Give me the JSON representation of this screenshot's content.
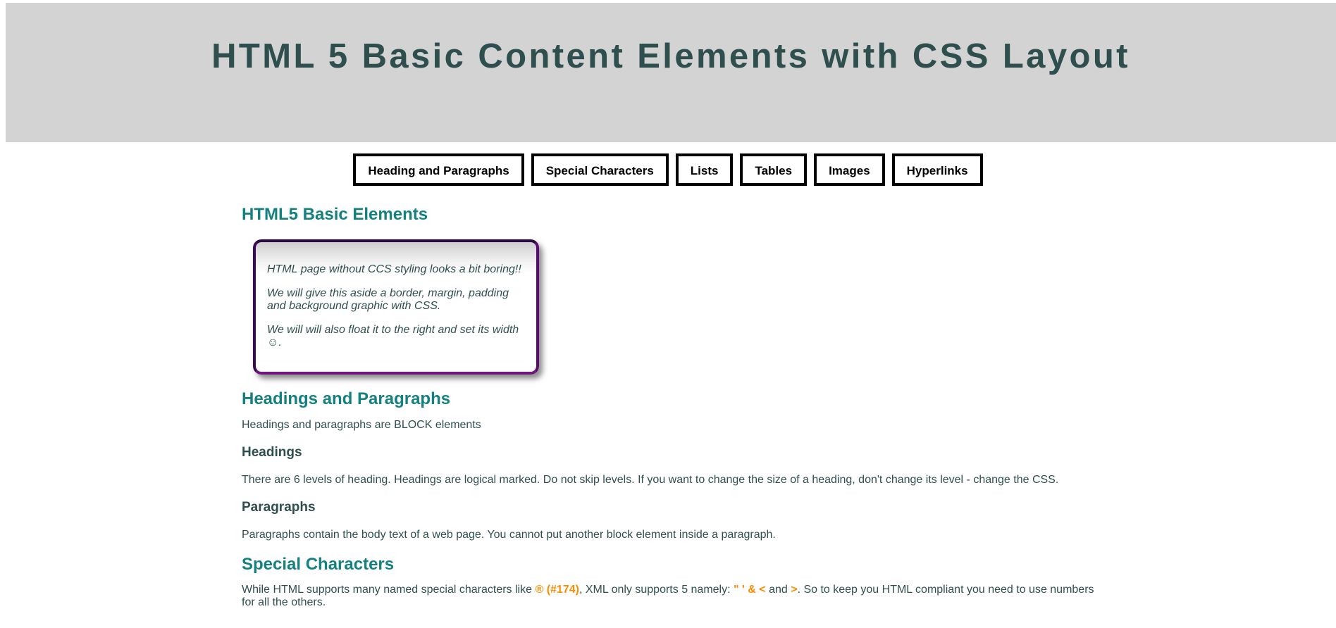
{
  "header": {
    "title": "HTML 5 Basic Content Elements with CSS Layout"
  },
  "nav": {
    "items": [
      "Heading and Paragraphs",
      "Special Characters",
      "Lists",
      "Tables",
      "Images",
      "Hyperlinks"
    ]
  },
  "main": {
    "basic_title": "HTML5 Basic Elements",
    "aside": {
      "p1": "HTML page without CCS styling looks a bit boring!!",
      "p2": "We will give this aside a border, margin, padding and background graphic with CSS.",
      "p3": "We will will also float it to the right and set its width ☺."
    },
    "headings_paragraphs": {
      "title": "Headings and Paragraphs",
      "intro": "Headings and paragraphs are BLOCK elements",
      "headings_title": "Headings",
      "headings_text": "There are 6 levels of heading. Headings are logical marked. Do not skip levels. If you want to change the size of a heading, don't change its level - change the CSS.",
      "paragraphs_title": "Paragraphs",
      "paragraphs_text": "Paragraphs contain the body text of a web page. You cannot put another block element inside a paragraph."
    },
    "special": {
      "title": "Special Characters",
      "text_1": "While HTML supports many named special characters like ",
      "reg": "® (#174)",
      "text_2": ", XML only supports 5 namely: ",
      "xml_chars": "\" ' & <",
      "text_3": " and ",
      "gt": ">",
      "text_4": ". So to keep you HTML compliant you need to use numbers for all the others."
    }
  },
  "colors": {
    "banner_bg": "#d3d3d3",
    "title": "#2f4f4f",
    "section_heading": "#148080",
    "highlight": "#ff8c00",
    "aside_border": "#4b0a5f"
  }
}
